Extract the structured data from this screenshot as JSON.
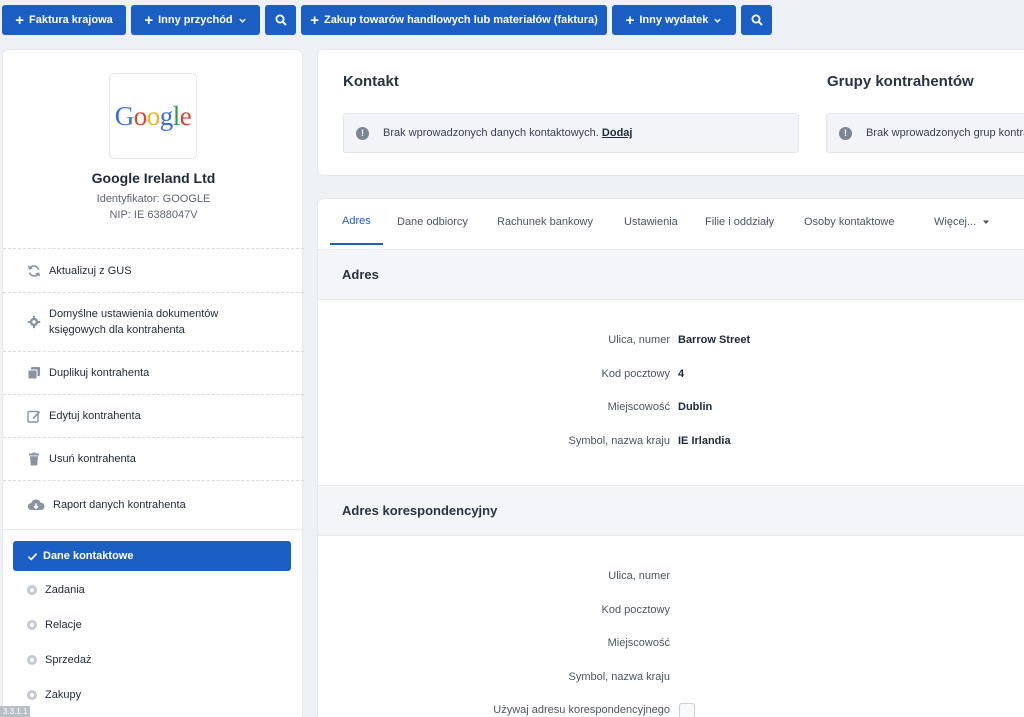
{
  "toolbar": {
    "btn_invoice": "Faktura krajowa",
    "btn_other_income": "Inny przychód",
    "btn_purchase": "Zakup towarów handlowych lub materiałów (faktura)",
    "btn_other_expense": "Inny wydatek"
  },
  "colors": {
    "accent": "#1b5ec4",
    "background": "#eef1f6"
  },
  "company": {
    "logo_letters": [
      "G",
      "o",
      "o",
      "g",
      "l",
      "e"
    ],
    "logo_colors": [
      "#3b6fd8",
      "#d9442f",
      "#f2b31b",
      "#3b6fd8",
      "#2b9a4a",
      "#d9442f"
    ],
    "name": "Google Ireland Ltd",
    "identifier": "Identyfikator: GOOGLE",
    "nip": "NIP: IE 6388047V"
  },
  "actions": {
    "gus": "Aktualizuj z GUS",
    "defaults": "Domyślne ustawienia dokumentów księgowych dla kontrahenta",
    "duplicate": "Duplikuj kontrahenta",
    "edit": "Edytuj kontrahenta",
    "delete": "Usuń kontrahenta",
    "report": "Raport danych kontrahenta"
  },
  "nav": {
    "active": "Dane kontaktowe",
    "items": [
      "Zadania",
      "Relacje",
      "Sprzedaż",
      "Zakupy"
    ]
  },
  "version": "3.3.1.1",
  "contact": {
    "title": "Kontakt",
    "info": "Brak wprowadzonych danych kontaktowych.",
    "add_link": "Dodaj"
  },
  "groups": {
    "title": "Grupy kontrahentów",
    "info": "Brak wprowadzonych grup kontrahentów."
  },
  "tabs": {
    "address": "Adres",
    "recipient": "Dane odbiorcy",
    "bank": "Rachunek bankowy",
    "settings": "Ustawienia",
    "branches": "Filie i oddziały",
    "persons": "Osoby kontaktowe",
    "more": "Więcej..."
  },
  "address": {
    "title": "Adres",
    "street_label": "Ulica, numer",
    "street_value": "Barrow Street",
    "postcode_label": "Kod pocztowy",
    "postcode_value": "4",
    "city_label": "Miejscowość",
    "city_value": "Dublin",
    "country_label": "Symbol, nazwa kraju",
    "country_value": "IE Irlandia"
  },
  "correspondence": {
    "title": "Adres korespondencyjny",
    "street_label": "Ulica, numer",
    "postcode_label": "Kod pocztowy",
    "city_label": "Miejscowość",
    "country_label": "Symbol, nazwa kraju",
    "use_label": "Używaj adresu korespondencyjnego"
  }
}
